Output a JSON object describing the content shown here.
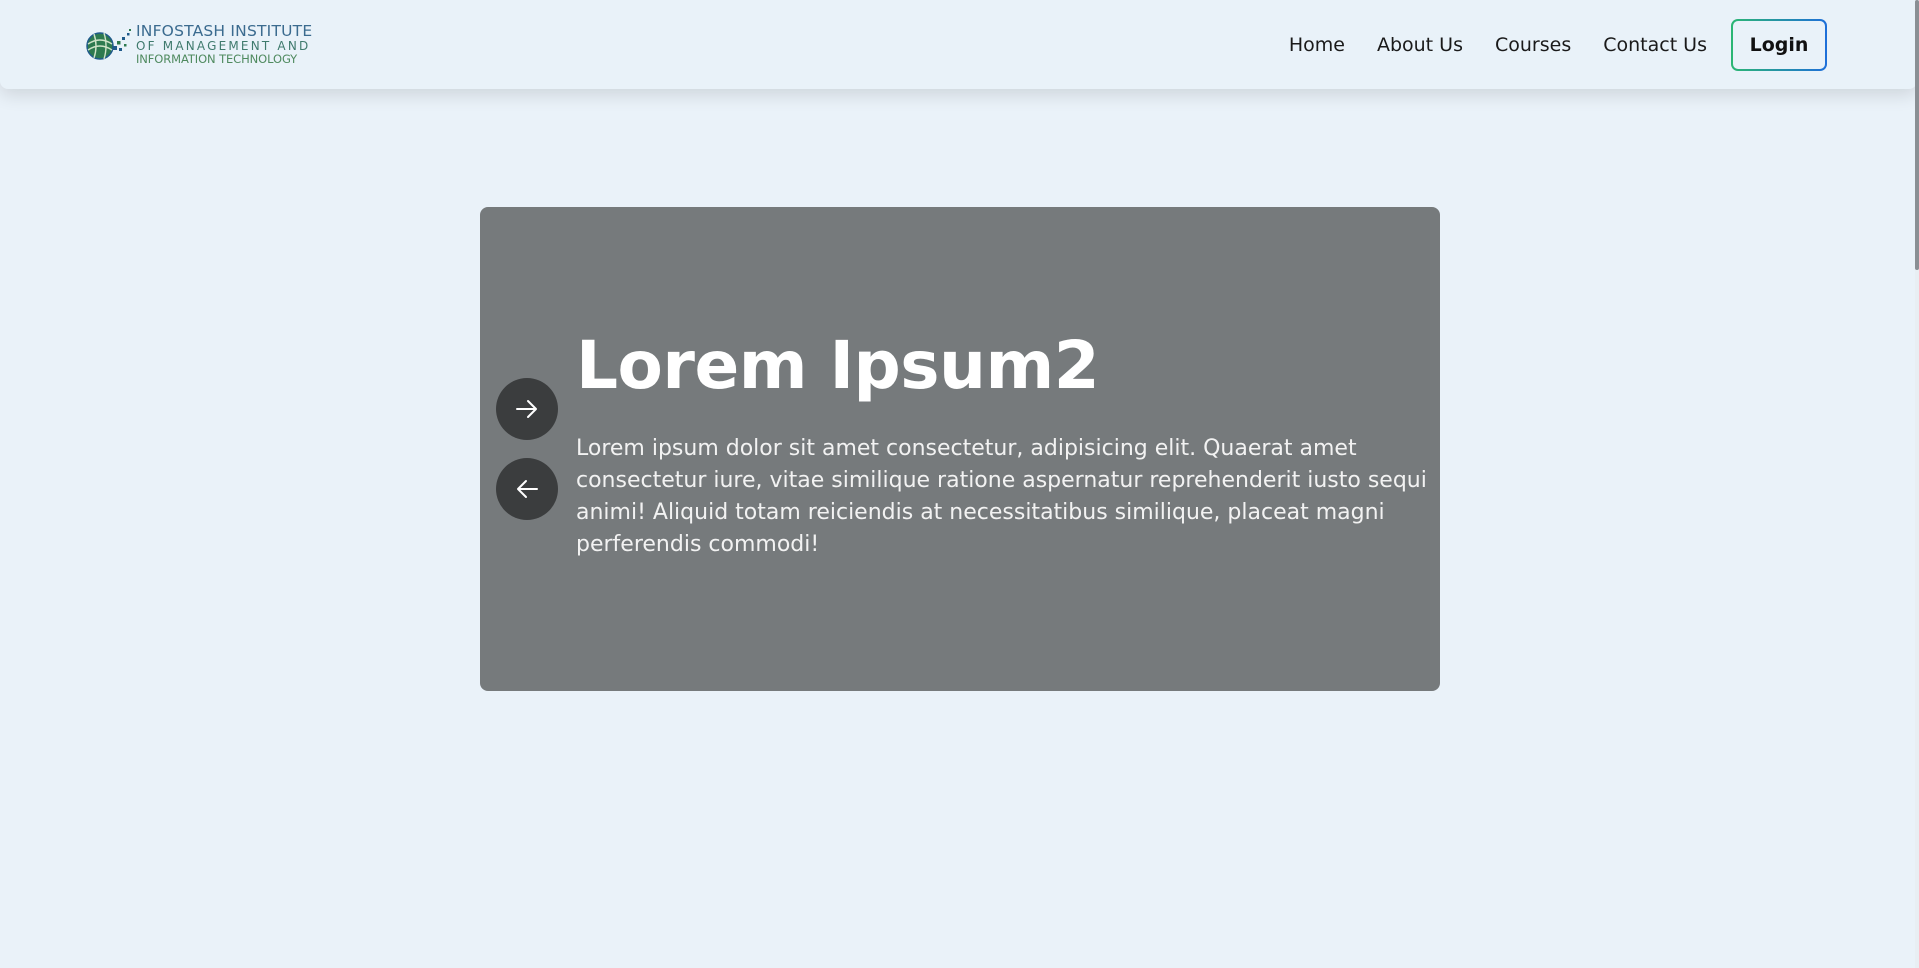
{
  "header": {
    "logo": {
      "line1": "INFOSTASH INSTITUTE",
      "line2": "OF MANAGEMENT AND",
      "line3": "INFORMATION TECHNOLOGY"
    },
    "nav": [
      {
        "label": "Home"
      },
      {
        "label": "About Us"
      },
      {
        "label": "Courses"
      },
      {
        "label": "Contact Us"
      }
    ],
    "login_label": "Login"
  },
  "hero": {
    "title": "Lorem Ipsum2",
    "text": "Lorem ipsum dolor sit amet consectetur, adipisicing elit. Quaerat amet consectetur iure, vitae similique ratione aspernatur reprehenderit iusto sequi animi! Aliquid totam reiciendis at necessitatibus similique, placeat magni perferendis commodi!",
    "next_icon": "arrow-right-icon",
    "prev_icon": "arrow-left-icon"
  },
  "colors": {
    "page_bg": "#eaf2f9",
    "hero_bg": "#767a7c",
    "arrow_bg": "#3b3d3e",
    "login_border_start": "#2bb673",
    "login_border_end": "#1e6fd9"
  }
}
